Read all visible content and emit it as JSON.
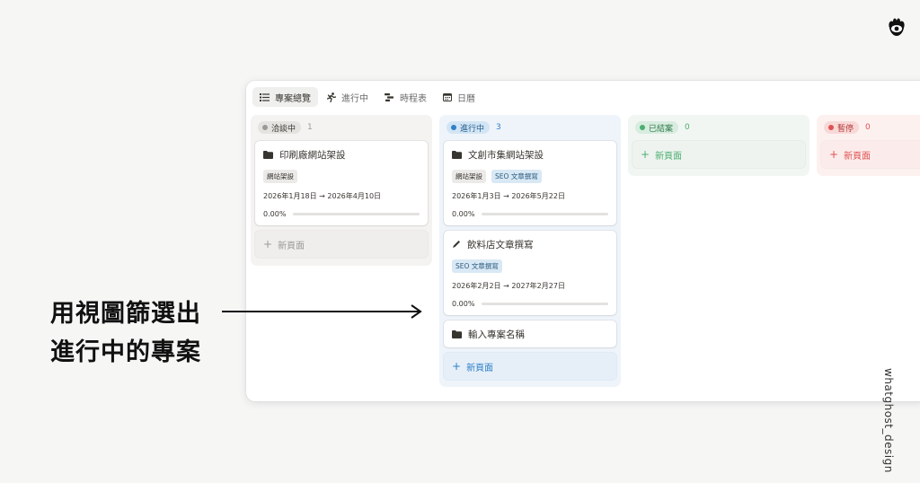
{
  "tabs": [
    {
      "label": "專案總覽",
      "icon": "list-icon",
      "active": true
    },
    {
      "label": "進行中",
      "icon": "running-person-icon",
      "active": false
    },
    {
      "label": "時程表",
      "icon": "timeline-icon",
      "active": false
    },
    {
      "label": "日曆",
      "icon": "calendar-icon",
      "active": false
    }
  ],
  "columns": {
    "planning": {
      "label": "洽談中",
      "count": "1",
      "color": "#9b9a97"
    },
    "in_progress": {
      "label": "進行中",
      "count": "3",
      "color": "#2f80c8"
    },
    "done": {
      "label": "已結案",
      "count": "0",
      "color": "#4caf72"
    },
    "paused": {
      "label": "暫停",
      "count": "0",
      "color": "#e05252"
    }
  },
  "cards": {
    "printing": {
      "title": "印刷廠網站架設",
      "icon": "folder-icon",
      "tags": [
        "網站架設"
      ],
      "dates": "2026年1月18日 → 2026年4月10日",
      "progress_label": "0.00%",
      "progress": 0
    },
    "market": {
      "title": "文創市集網站架設",
      "icon": "folder-icon",
      "tags": [
        "網站架設",
        "SEO 文章撰寫"
      ],
      "dates": "2026年1月3日 → 2026年5月22日",
      "progress_label": "0.00%",
      "progress": 0
    },
    "drinks": {
      "title": "飲料店文章撰寫",
      "icon": "pencil-icon",
      "tags": [
        "SEO 文章撰寫"
      ],
      "dates": "2026年2月2日 → 2027年2月27日",
      "progress_label": "0.00%",
      "progress": 0
    },
    "placeholder": {
      "title": "輸入專案名稱",
      "icon": "folder-icon"
    }
  },
  "new_page_label": "新頁面",
  "caption": {
    "line1": "用視圖篩選出",
    "line2": "進行中的專案"
  },
  "credit": "whatghost_design"
}
